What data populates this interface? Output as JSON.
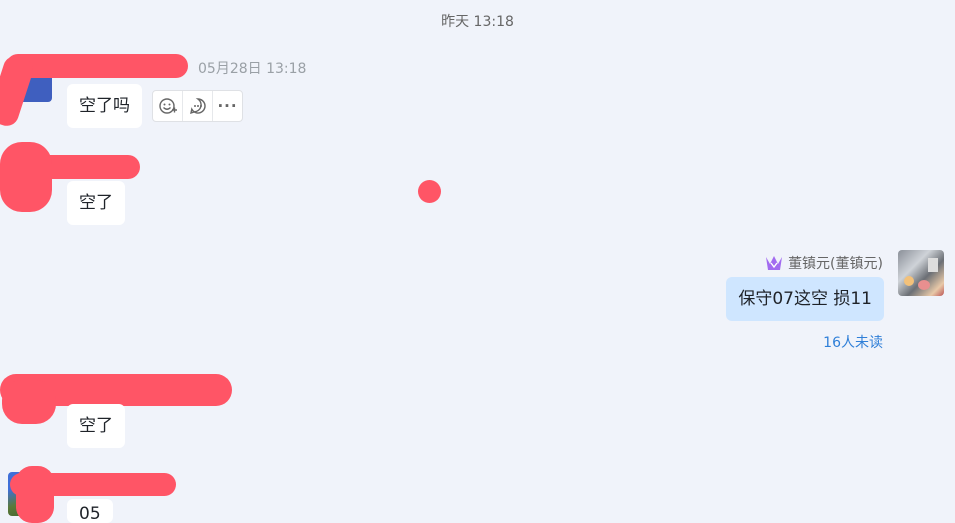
{
  "divider_time": "昨天 13:18",
  "messages": [
    {
      "timestamp": "05月28日 13:18",
      "text": "空了吗"
    },
    {
      "text": "空了"
    },
    {
      "sender": "董镇元(董镇元)",
      "text": "保守07这空 损11",
      "read_status": "16人未读"
    },
    {
      "text": "空了"
    },
    {
      "text": "05"
    }
  ],
  "hover_actions": {
    "emoji_icon": "emoji-add-icon",
    "reply_icon": "comment-icon",
    "more_label": "···"
  },
  "colors": {
    "background": "#f0f3fa",
    "bubble_other": "#ffffff",
    "bubble_mine": "#cfe6ff",
    "redaction": "#ff5566",
    "read_status": "#2f7fd8",
    "crown_badge": "#a26bf0"
  }
}
